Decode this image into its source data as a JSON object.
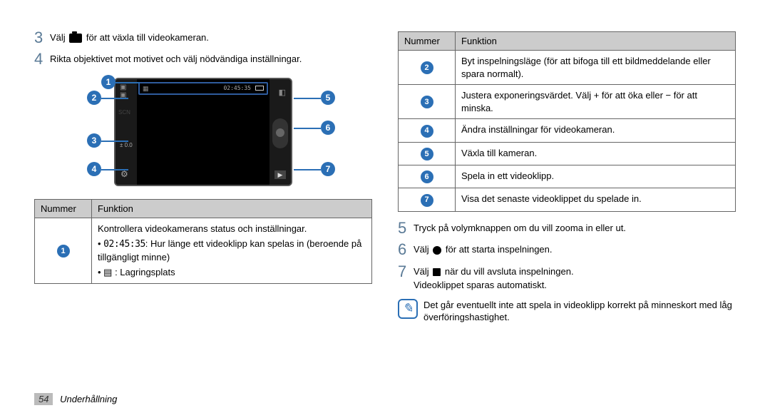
{
  "left": {
    "step3_prefix": "Välj",
    "step3_suffix": " för att växla till videokameran.",
    "step4": "Rikta objektivet mot motivet och välj nödvändiga inställningar.",
    "topbar_time": "02:45:35",
    "table": {
      "head_num": "Nummer",
      "head_func": "Funktion",
      "row1_line1": "Kontrollera videokamerans status och inställningar.",
      "row1_bullet1_time": "02:45:35",
      "row1_bullet1_rest": ": Hur länge ett videoklipp kan spelas in (beroende på tillgängligt minne)",
      "row1_bullet2": " : Lagringsplats"
    }
  },
  "right": {
    "table": {
      "head_num": "Nummer",
      "head_func": "Funktion",
      "r2": "Byt inspelningsläge (för att bifoga till ett bildmeddelande eller spara normalt).",
      "r3": "Justera exponeringsvärdet. Välj + för att öka eller − för att minska.",
      "r4": "Ändra inställningar för videokameran.",
      "r5": "Växla till kameran.",
      "r6": "Spela in ett videoklipp.",
      "r7": "Visa det senaste videoklippet du spelade in."
    },
    "step5": "Tryck på volymknappen om du vill zooma in eller ut.",
    "step6_prefix": "Välj ",
    "step6_suffix": " för att starta inspelningen.",
    "step7_prefix": "Välj ",
    "step7_suffix": " när du vill avsluta inspelningen.",
    "step7_extra": "Videoklippet sparas automatiskt.",
    "note": "Det går eventuellt inte att spela in videoklipp korrekt på minneskort med låg överföringshastighet."
  },
  "footer": {
    "page": "54",
    "section": "Underhållning"
  },
  "nums": [
    "1",
    "2",
    "3",
    "4",
    "5",
    "6",
    "7"
  ]
}
